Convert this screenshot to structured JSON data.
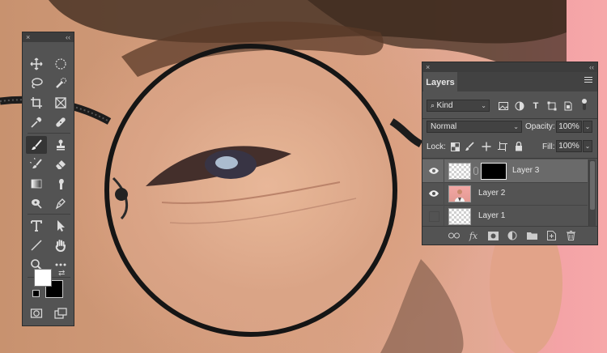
{
  "tools_panel": {
    "close_glyph": "×",
    "collapse_glyph": "‹‹",
    "tools": [
      {
        "name": "move-tool",
        "icon": "move-icon"
      },
      {
        "name": "elliptical-marquee-tool",
        "icon": "ellipse-marquee-icon"
      },
      {
        "name": "lasso-tool",
        "icon": "lasso-icon"
      },
      {
        "name": "quick-selection-tool",
        "icon": "quick-selection-icon"
      },
      {
        "name": "crop-tool",
        "icon": "crop-icon"
      },
      {
        "name": "frame-tool",
        "icon": "frame-icon"
      },
      {
        "name": "eyedropper-tool",
        "icon": "eyedropper-icon"
      },
      {
        "name": "healing-brush-tool",
        "icon": "bandage-icon"
      },
      {
        "name": "brush-tool",
        "icon": "brush-icon",
        "active": true
      },
      {
        "name": "clone-stamp-tool",
        "icon": "stamp-icon"
      },
      {
        "name": "history-brush-tool",
        "icon": "history-brush-icon"
      },
      {
        "name": "eraser-tool",
        "icon": "eraser-icon"
      },
      {
        "name": "gradient-tool",
        "icon": "gradient-icon"
      },
      {
        "name": "smudge-tool",
        "icon": "smudge-icon"
      },
      {
        "name": "dodge-tool",
        "icon": "dodge-icon"
      },
      {
        "name": "pen-tool",
        "icon": "pen-icon"
      },
      {
        "name": "type-tool",
        "icon": "type-icon"
      },
      {
        "name": "path-selection-tool",
        "icon": "arrow-icon"
      },
      {
        "name": "line-tool",
        "icon": "line-icon"
      },
      {
        "name": "hand-tool",
        "icon": "hand-icon"
      },
      {
        "name": "zoom-tool",
        "icon": "zoom-icon"
      },
      {
        "name": "more-tools",
        "icon": "ellipsis-icon"
      }
    ],
    "foreground_color": "#ffffff",
    "background_color": "#000000"
  },
  "layers_panel": {
    "close_glyph": "×",
    "collapse_glyph": "‹‹",
    "tab_label": "Layers",
    "filter": {
      "kind_label": "Kind"
    },
    "blend_mode": "Normal",
    "opacity_label": "Opacity:",
    "opacity_value": "100%",
    "lock_label": "Lock:",
    "fill_label": "Fill:",
    "fill_value": "100%",
    "layers": [
      {
        "name": "Layer 3",
        "visible": true,
        "selected": true,
        "has_mask": true
      },
      {
        "name": "Layer 2",
        "visible": true,
        "selected": false,
        "has_mask": false
      },
      {
        "name": "Layer 1",
        "visible": false,
        "selected": false,
        "has_mask": false
      }
    ]
  },
  "colors": {
    "panel_bg": "#535353",
    "panel_header": "#3d3d3d",
    "selected_layer": "#6a6a6a",
    "pink_backdrop": "#f6a8a9",
    "skin_tone": "#d9a080"
  }
}
